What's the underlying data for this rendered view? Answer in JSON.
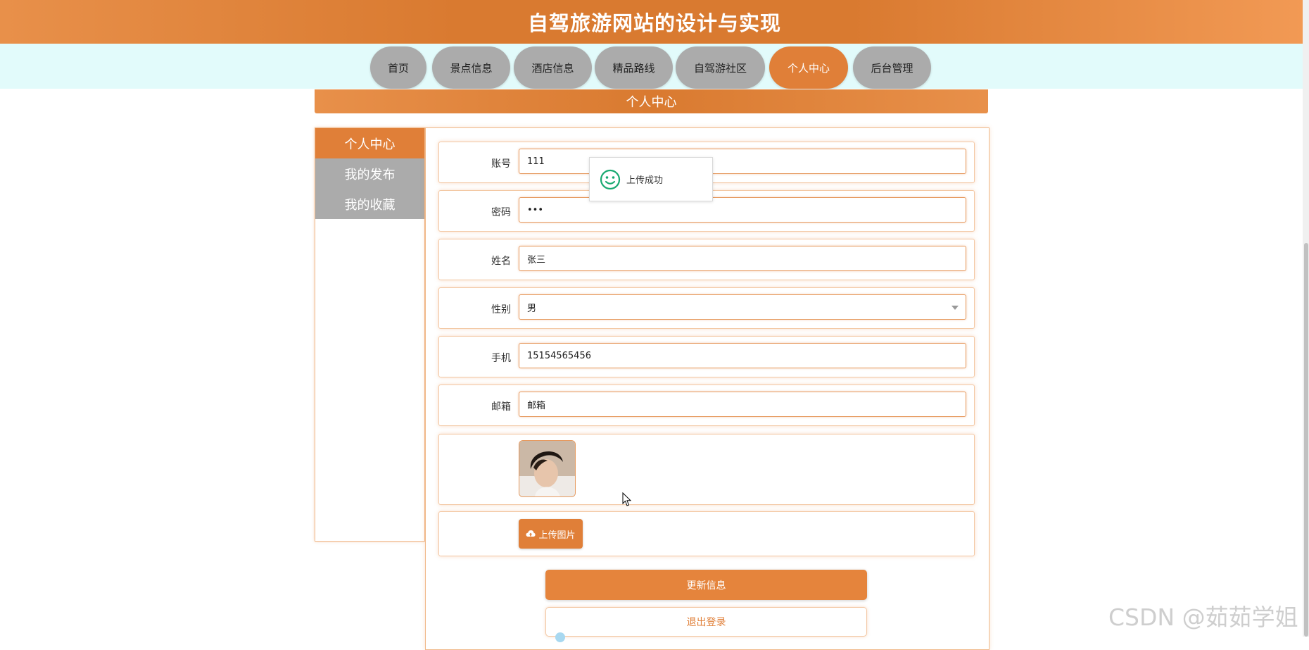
{
  "header": {
    "title": "自驾旅游网站的设计与实现"
  },
  "nav": {
    "items": [
      {
        "label": "首页"
      },
      {
        "label": "景点信息"
      },
      {
        "label": "酒店信息"
      },
      {
        "label": "精品路线"
      },
      {
        "label": "自驾游社区"
      },
      {
        "label": "个人中心"
      },
      {
        "label": "后台管理"
      }
    ],
    "active": "个人中心"
  },
  "section": {
    "title": "个人中心"
  },
  "sidebar": {
    "items": [
      {
        "label": "个人中心"
      },
      {
        "label": "我的发布"
      },
      {
        "label": "我的收藏"
      }
    ],
    "active": "个人中心"
  },
  "form": {
    "account": {
      "label": "账号",
      "value": "111"
    },
    "password": {
      "label": "密码",
      "value": "•••"
    },
    "name": {
      "label": "姓名",
      "value": "张三"
    },
    "gender": {
      "label": "性别",
      "value": "男"
    },
    "phone": {
      "label": "手机",
      "value": "15154565456"
    },
    "email": {
      "label": "邮箱",
      "value": "邮箱"
    },
    "upload_label": "上传图片"
  },
  "buttons": {
    "update": "更新信息",
    "logout": "退出登录"
  },
  "toast": {
    "message": "上传成功"
  },
  "watermark": "CSDN @茹茹学姐",
  "colors": {
    "accent": "#e07f38",
    "nav_inactive": "#ababab",
    "nav_bg": "#e2fbfb",
    "toast_icon": "#19a971"
  }
}
